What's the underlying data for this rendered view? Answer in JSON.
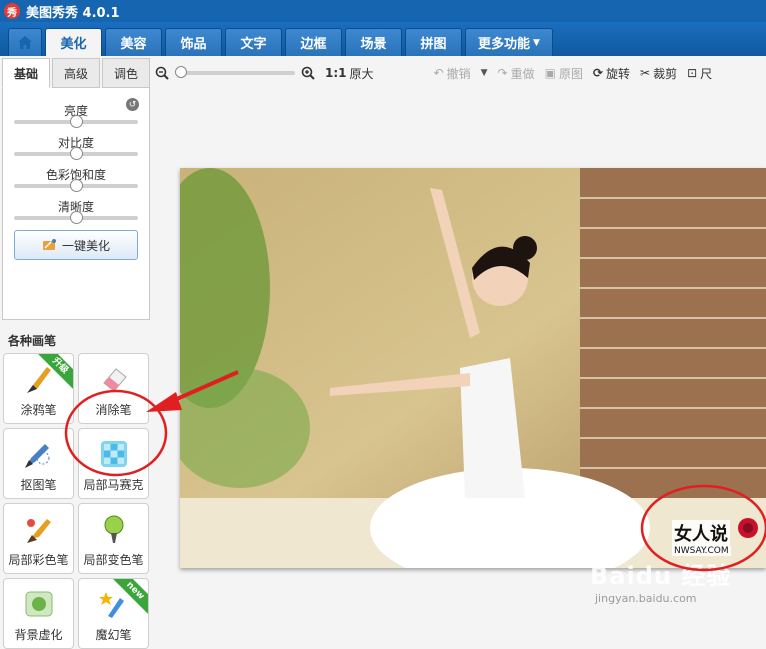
{
  "app": {
    "logo": "秀",
    "title": "美图秀秀 4.0.1"
  },
  "tabs": [
    {
      "icon": "home-icon",
      "label": ""
    },
    {
      "label": "美化",
      "active": true
    },
    {
      "label": "美容"
    },
    {
      "label": "饰品"
    },
    {
      "label": "文字"
    },
    {
      "label": "边框"
    },
    {
      "label": "场景"
    },
    {
      "label": "拼图"
    },
    {
      "label": "更多功能"
    }
  ],
  "toolbar": {
    "zoom_ratio": "1:1",
    "original_size": "原大",
    "undo": "撤销",
    "redo": "重做",
    "original": "原图",
    "rotate": "旋转",
    "crop": "裁剪",
    "resize": "尺"
  },
  "left_panel": {
    "subtabs": [
      "基础",
      "高级",
      "调色"
    ],
    "sliders": [
      {
        "label": "亮度",
        "value": 0.5
      },
      {
        "label": "对比度",
        "value": 0.5
      },
      {
        "label": "色彩饱和度",
        "value": 0.5
      },
      {
        "label": "清晰度",
        "value": 0.5
      }
    ],
    "one_click_label": "一键美化",
    "brushes_title": "各种画笔",
    "brushes": [
      {
        "label": "涂鸦笔",
        "badge": "升级"
      },
      {
        "label": "消除笔",
        "badge": ""
      },
      {
        "label": "抠图笔",
        "badge": ""
      },
      {
        "label": "局部马赛克",
        "badge": ""
      },
      {
        "label": "局部彩色笔",
        "badge": ""
      },
      {
        "label": "局部变色笔",
        "badge": ""
      },
      {
        "label": "背景虚化",
        "badge": ""
      },
      {
        "label": "魔幻笔",
        "badge": "new"
      }
    ]
  },
  "watermark": {
    "text": "女人说",
    "sub": "NWSAY.COM"
  },
  "baidu_watermark": {
    "text": "Baidu 经验",
    "url": "jingyan.baidu.com"
  },
  "colors": {
    "title_bar": "#1565b0",
    "tab_active_text": "#1565b0",
    "annotation_red": "#e02020"
  }
}
